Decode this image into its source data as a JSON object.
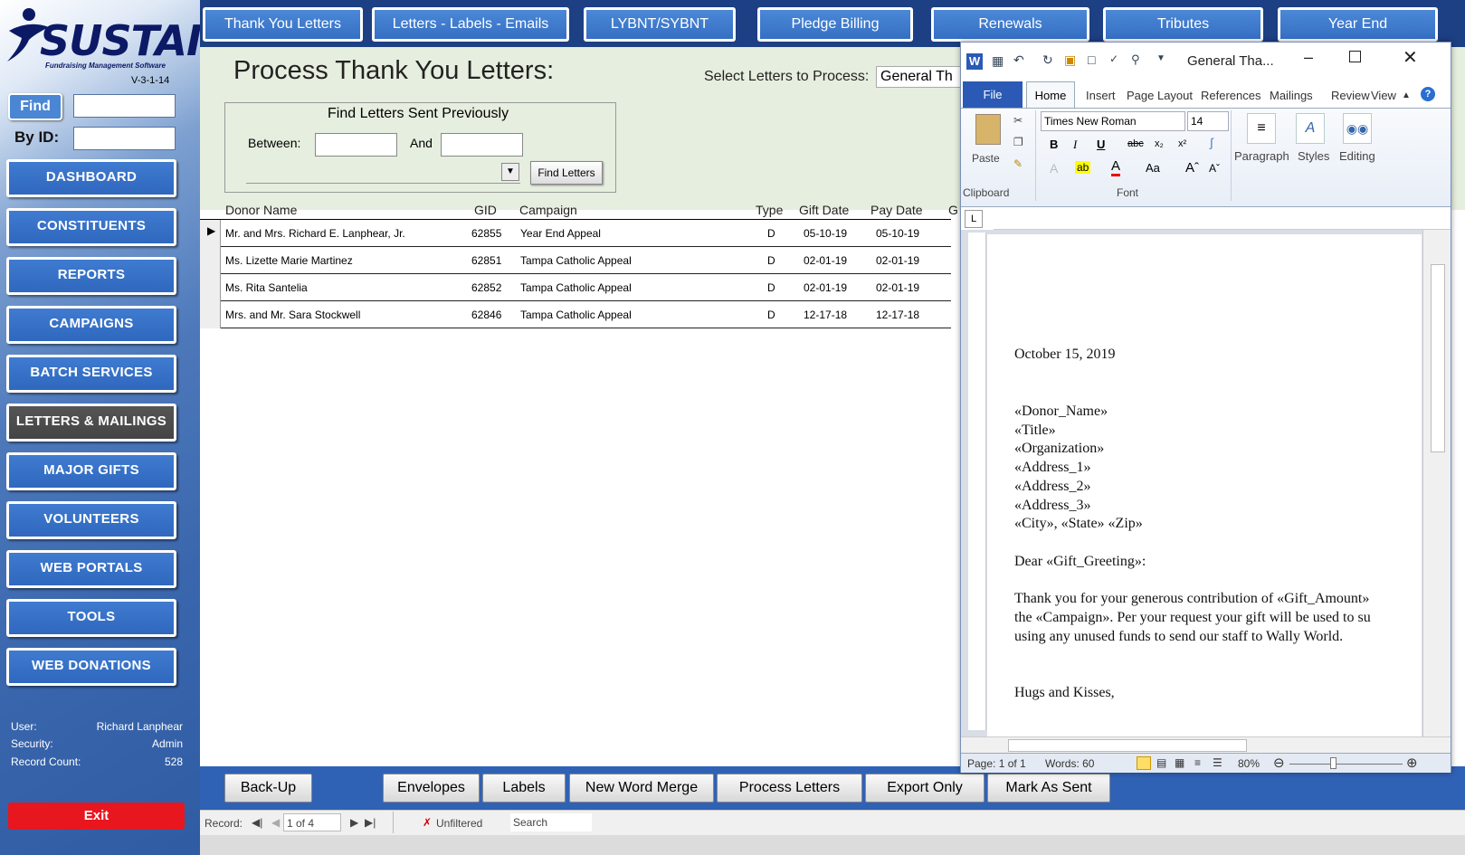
{
  "app": {
    "logo": "SUSTAIN",
    "tagline": "Fundraising Management Software",
    "version": "V-3-1-14"
  },
  "sidebar": {
    "find_label": "Find",
    "byid_label": "By ID:",
    "nav": [
      "DASHBOARD",
      "CONSTITUENTS",
      "REPORTS",
      "CAMPAIGNS",
      "BATCH SERVICES",
      "LETTERS & MAILINGS",
      "MAJOR GIFTS",
      "VOLUNTEERS",
      "WEB PORTALS",
      "TOOLS",
      "WEB DONATIONS"
    ],
    "active": "LETTERS & MAILINGS",
    "user_label": "User:",
    "user_value": "Richard Lanphear",
    "security_label": "Security:",
    "security_value": "Admin",
    "record_label": "Record Count:",
    "record_value": "528",
    "exit_label": "Exit"
  },
  "tabs": [
    "Thank You Letters",
    "Letters - Labels - Emails",
    "LYBNT/SYBNT",
    "Pledge Billing",
    "Renewals",
    "Tributes",
    "Year End"
  ],
  "form": {
    "title": "Process Thank You Letters:",
    "select_label": "Select Letters to Process:",
    "select_value": "General Th",
    "find_box_title": "Find Letters Sent Previously",
    "between_label": "Between:",
    "and_label": "And",
    "find_button": "Find Letters"
  },
  "table": {
    "headers": [
      "Donor Name",
      "GID",
      "Campaign",
      "Type",
      "Gift Date",
      "Pay Date",
      "G"
    ],
    "rows": [
      {
        "name": "Mr. and Mrs. Richard E. Lanphear, Jr.",
        "gid": "62855",
        "campaign": "Year End Appeal",
        "type": "D",
        "gift_date": "05-10-19",
        "pay_date": "05-10-19"
      },
      {
        "name": "Ms. Lizette Marie Martinez",
        "gid": "62851",
        "campaign": "Tampa Catholic Appeal",
        "type": "D",
        "gift_date": "02-01-19",
        "pay_date": "02-01-19"
      },
      {
        "name": "Ms. Rita Santelia",
        "gid": "62852",
        "campaign": "Tampa Catholic Appeal",
        "type": "D",
        "gift_date": "02-01-19",
        "pay_date": "02-01-19"
      },
      {
        "name": "Mrs. and Mr. Sara Stockwell",
        "gid": "62846",
        "campaign": "Tampa Catholic Appeal",
        "type": "D",
        "gift_date": "12-17-18",
        "pay_date": "12-17-18"
      }
    ]
  },
  "bottom_buttons": {
    "backup": "Back-Up",
    "envelopes": "Envelopes",
    "labels": "Labels",
    "new_merge": "New Word Merge",
    "process": "Process Letters",
    "export": "Export Only",
    "mark_sent": "Mark As Sent"
  },
  "record_nav": {
    "label": "Record:",
    "position": "1 of 4",
    "filter": "Unfiltered",
    "search": "Search"
  },
  "word": {
    "title": "General Tha...",
    "file_tab": "File",
    "tabs": [
      "Home",
      "Insert",
      "Page Layout",
      "References",
      "Mailings",
      "Review",
      "View"
    ],
    "font_name": "Times New Roman",
    "font_size": "14",
    "paste": "Paste",
    "clipboard": "Clipboard",
    "font_group": "Font",
    "paragraph": "Paragraph",
    "styles": "Styles",
    "editing": "Editing",
    "doc_lines": {
      "date": "October 15, 2019",
      "l1": "«Donor_Name»",
      "l2": "«Title»",
      "l3": "«Organization»",
      "l4": "«Address_1»",
      "l5": "«Address_2»",
      "l6": "«Address_3»",
      "l7": "«City», «State»  «Zip»",
      "greeting": "Dear «Gift_Greeting»:",
      "p1": "Thank you for your generous contribution of «Gift_Amount»",
      "p2": "the «Campaign».  Per your request your gift will be used to su",
      "p3": "using any unused funds to send our staff to Wally World.",
      "closing": "Hugs and Kisses,"
    },
    "status_page": "Page: 1 of 1",
    "status_words": "Words: 60",
    "zoom": "80%"
  },
  "colors": {
    "nav_blue": "#3f7bd0",
    "active_nav": "#4a4a4a",
    "topbar": "#1d3f83",
    "form_bg": "#e6eedf",
    "exit_red": "#e8161f",
    "word_blue": "#2a5ab5"
  }
}
